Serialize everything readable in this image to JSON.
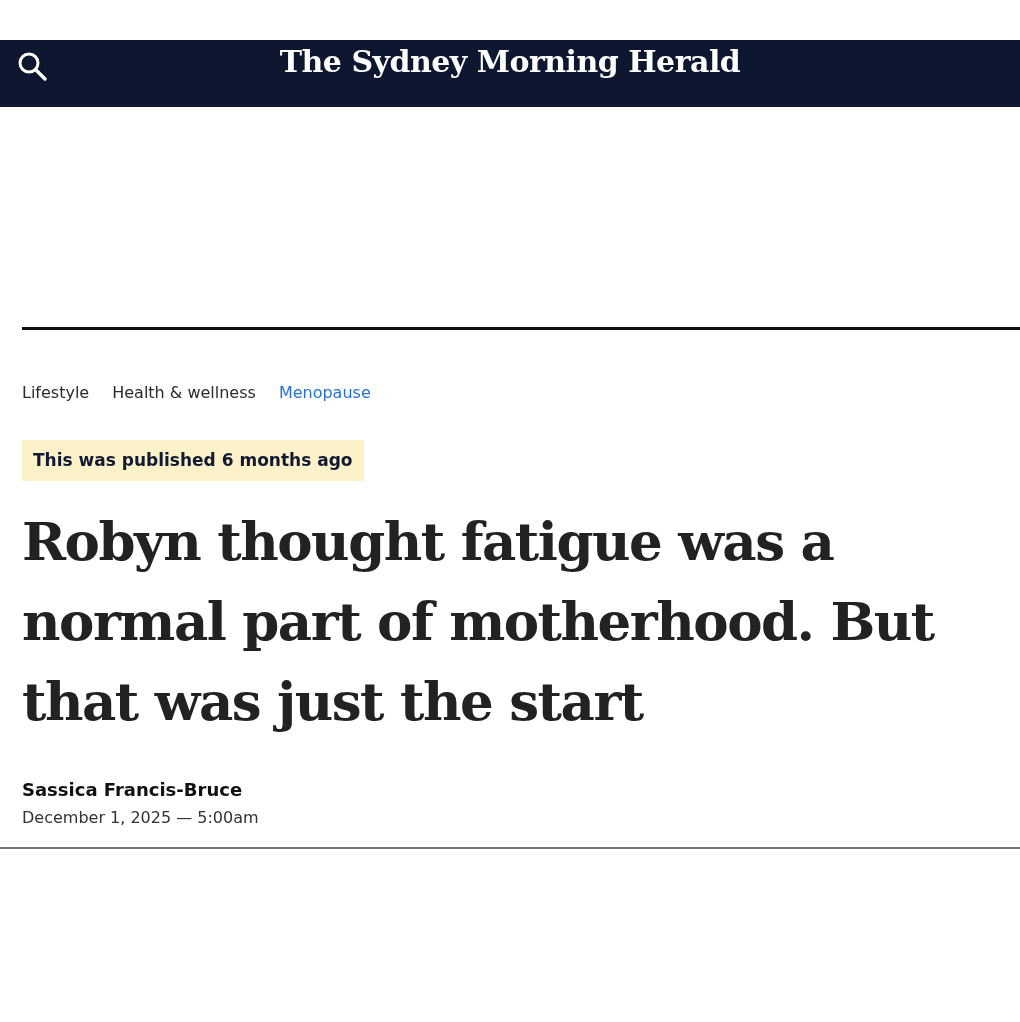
{
  "header": {
    "logo": "The Sydney Morning Herald"
  },
  "breadcrumbs": [
    {
      "label": "Lifestyle",
      "highlighted": false
    },
    {
      "label": "Health & wellness",
      "highlighted": false
    },
    {
      "label": "Menopause",
      "highlighted": true
    }
  ],
  "notice": "This was published 6 months ago",
  "headline": "Robyn thought fatigue was a normal part of motherhood. But that was just the start",
  "byline": {
    "author": "Sassica Francis-Bruce",
    "date": "December 1, 2025 — 5:00am"
  }
}
